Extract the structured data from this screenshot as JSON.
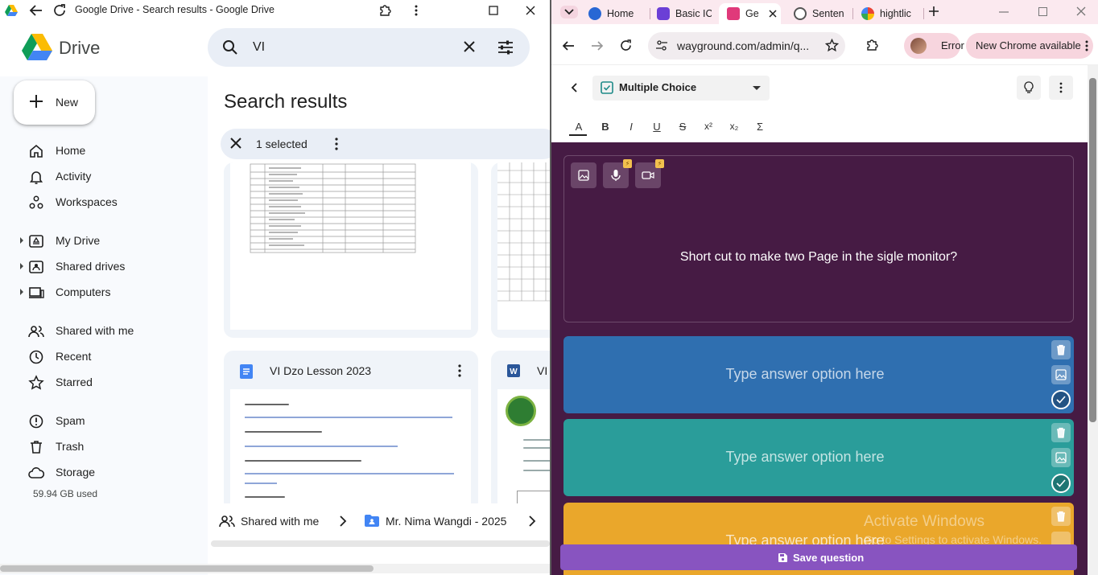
{
  "left_window": {
    "title": "Google Drive - Search results - Google Drive",
    "drive": {
      "brand": "Drive",
      "search": {
        "value": "VI"
      },
      "new_button": "New",
      "nav": [
        {
          "label": "Home",
          "icon": "home-icon"
        },
        {
          "label": "Activity",
          "icon": "bell-icon"
        },
        {
          "label": "Workspaces",
          "icon": "workspaces-icon"
        },
        {
          "label": "My Drive",
          "icon": "my-drive-icon"
        },
        {
          "label": "Shared drives",
          "icon": "shared-drives-icon"
        },
        {
          "label": "Computers",
          "icon": "computer-icon"
        },
        {
          "label": "Shared with me",
          "icon": "people-icon"
        },
        {
          "label": "Recent",
          "icon": "clock-icon"
        },
        {
          "label": "Starred",
          "icon": "star-icon"
        },
        {
          "label": "Spam",
          "icon": "spam-icon"
        },
        {
          "label": "Trash",
          "icon": "trash-icon"
        },
        {
          "label": "Storage",
          "icon": "cloud-icon"
        }
      ],
      "storage_used": "59.94 GB used",
      "results_title": "Search results",
      "selection_text": "1 selected",
      "files": [
        {
          "name": "VI Dzo Lesson 2023",
          "type": "google-docs"
        },
        {
          "name": "VI",
          "type": "word"
        }
      ],
      "breadcrumb": {
        "shared": "Shared with me",
        "folder": "Mr. Nima Wangdi - 2025"
      }
    }
  },
  "right_window": {
    "tabs": [
      {
        "label": "Home"
      },
      {
        "label": "Basic IC"
      },
      {
        "label": "Ge"
      },
      {
        "label": "Senten"
      },
      {
        "label": "hightlic"
      }
    ],
    "address": {
      "url": "wayground.com/admin/q..."
    },
    "profile_label": "Error",
    "update_label": "New Chrome available",
    "editor": {
      "question_type": "Multiple Choice",
      "format_tools": [
        "A",
        "B",
        "I",
        "U",
        "S",
        "x²",
        "x₂",
        "Σ"
      ],
      "question_text": "Short cut to make two Page in the sigle monitor?",
      "answers": [
        {
          "placeholder": "Type answer option here",
          "color": "#2f6fb0"
        },
        {
          "placeholder": "Type answer option here",
          "color": "#2a9d9a"
        },
        {
          "placeholder": "Type answer option here",
          "color": "#eaa72b"
        }
      ],
      "save_label": "Save question"
    },
    "watermark": {
      "line1": "Activate Windows",
      "line2": "Go to Settings to activate Windows."
    }
  }
}
